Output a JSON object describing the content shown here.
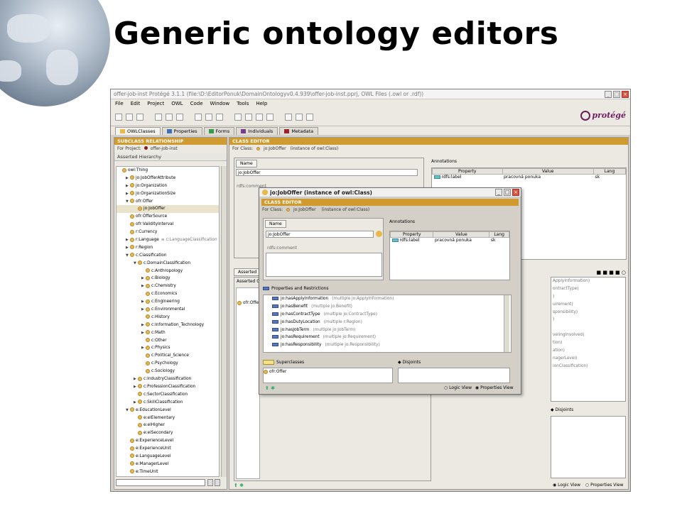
{
  "slide": {
    "title": "Generic ontology editors"
  },
  "window": {
    "title": "offer-job-inst  Protégé 3.1.1    (file:\\D:\\EditorPonuk\\DomainOntologyv0.4.939\\offer-job-inst.pprj, OWL Files (.owl or .rdf))",
    "logo_text": "protégé",
    "menu": [
      "File",
      "Edit",
      "Project",
      "OWL",
      "Code",
      "Window",
      "Tools",
      "Help"
    ],
    "tabs": [
      {
        "label": "OWLClasses",
        "color": "#e8b84a"
      },
      {
        "label": "Properties",
        "color": "#3f6fb8"
      },
      {
        "label": "Forms",
        "color": "#3a9a4a"
      },
      {
        "label": "Individuals",
        "color": "#7a3a8a"
      },
      {
        "label": "Metadata",
        "color": "#a0202a"
      }
    ]
  },
  "left": {
    "header": "SUBCLASS RELATIONSHIP",
    "for_project_label": "For Project:",
    "project": "offer-job-inst",
    "hierarchy_label": "Asserted Hierarchy",
    "tree": [
      {
        "label": "owl:Thing",
        "indent": 0,
        "arrow": ""
      },
      {
        "label": "jo:JobOfferAttribute",
        "indent": 1,
        "arrow": "▶"
      },
      {
        "label": "jo:Organization",
        "indent": 1,
        "arrow": "▶"
      },
      {
        "label": "jo:OrganizationSize",
        "indent": 1,
        "arrow": "▶"
      },
      {
        "label": "ofr:Offer",
        "indent": 1,
        "arrow": "▼"
      },
      {
        "label": "jo:JobOffer",
        "indent": 2,
        "arrow": "",
        "selected": true
      },
      {
        "label": "ofr:OfferSource",
        "indent": 1,
        "arrow": ""
      },
      {
        "label": "ofr:ValidityInterval",
        "indent": 1,
        "arrow": ""
      },
      {
        "label": "r:Currency",
        "indent": 1,
        "arrow": ""
      },
      {
        "label": "r:Language",
        "indent": 1,
        "arrow": "▶",
        "extra": "≡ c:LanguageClassification"
      },
      {
        "label": "r:Region",
        "indent": 1,
        "arrow": "▶"
      },
      {
        "label": "c:Classification",
        "indent": 1,
        "arrow": "▼"
      },
      {
        "label": "c:DomainClassification",
        "indent": 2,
        "arrow": "▼"
      },
      {
        "label": "c:Anthropology",
        "indent": 3,
        "arrow": ""
      },
      {
        "label": "c:Biology",
        "indent": 3,
        "arrow": "▶"
      },
      {
        "label": "c:Chemistry",
        "indent": 3,
        "arrow": "▶"
      },
      {
        "label": "c:Economics",
        "indent": 3,
        "arrow": ""
      },
      {
        "label": "c:Engineering",
        "indent": 3,
        "arrow": "▶"
      },
      {
        "label": "c:Environmental",
        "indent": 3,
        "arrow": "▶"
      },
      {
        "label": "c:History",
        "indent": 3,
        "arrow": ""
      },
      {
        "label": "c:Information_Technology",
        "indent": 3,
        "arrow": "▶"
      },
      {
        "label": "c:Math",
        "indent": 3,
        "arrow": "▶"
      },
      {
        "label": "c:Other",
        "indent": 3,
        "arrow": ""
      },
      {
        "label": "c:Physics",
        "indent": 3,
        "arrow": "▶"
      },
      {
        "label": "c:Political_Science",
        "indent": 3,
        "arrow": ""
      },
      {
        "label": "c:Psychology",
        "indent": 3,
        "arrow": ""
      },
      {
        "label": "c:Sociology",
        "indent": 3,
        "arrow": ""
      },
      {
        "label": "c:IndustryClassification",
        "indent": 2,
        "arrow": "▶"
      },
      {
        "label": "c:ProfessionClassification",
        "indent": 2,
        "arrow": "▶"
      },
      {
        "label": "c:SectorClassification",
        "indent": 2,
        "arrow": ""
      },
      {
        "label": "c:SkillClassification",
        "indent": 2,
        "arrow": "▶"
      },
      {
        "label": "e:EducationLevel",
        "indent": 1,
        "arrow": "▼"
      },
      {
        "label": "e:elElementary",
        "indent": 2,
        "arrow": ""
      },
      {
        "label": "e:elHigher",
        "indent": 2,
        "arrow": ""
      },
      {
        "label": "e:elSecondary",
        "indent": 2,
        "arrow": ""
      },
      {
        "label": "e:ExperienceLevel",
        "indent": 1,
        "arrow": ""
      },
      {
        "label": "e:ExperienceUnit",
        "indent": 1,
        "arrow": ""
      },
      {
        "label": "e:LanguageLevel",
        "indent": 1,
        "arrow": ""
      },
      {
        "label": "e:ManagerLevel",
        "indent": 1,
        "arrow": ""
      },
      {
        "label": "e:TimeUnit",
        "indent": 1,
        "arrow": ""
      }
    ]
  },
  "editor": {
    "header": "CLASS EDITOR",
    "for_class_label": "For Class:",
    "class_name": "jo:JobOffer",
    "instance_of": "(instance of owl:Class)",
    "name_tab": "Name",
    "name_value": "jo:JobOffer",
    "rdfs_comment": "rdfs:comment",
    "annotations_label": "Annotations",
    "ann_cols": [
      "Property",
      "Value",
      "Lang"
    ],
    "ann_row": {
      "property": "rdfs:label",
      "value": "pracovná ponuka",
      "lang": "sk"
    },
    "asserted_tab": "Asserted",
    "asserted_cond_label": "Asserted C",
    "asserted_item": "ofr:Offer",
    "disjoints_label": "Disjoints",
    "logic_view": "Logic View",
    "properties_view": "Properties View",
    "right_list": [
      "ApplyInformation)",
      "ontractType)",
      ")",
      "uirement)",
      "sponsibility)",
      ")",
      "",
      "velingInvolved)",
      "tion)",
      "ation)",
      "nagerLevel)",
      "ionClassification)"
    ]
  },
  "dialog": {
    "title": "jo:JobOffer    (instance of owl:Class)",
    "header": "CLASS EDITOR",
    "for_class_label": "For Class:",
    "class_name": "jo:JobOffer",
    "instance_of": "(instance of owl:Class)",
    "name_tab": "Name",
    "name_value": "jo:JobOffer",
    "rdfs_comment": "rdfs:comment",
    "annotations_label": "Annotations",
    "ann_cols": [
      "Property",
      "Value",
      "Lang"
    ],
    "ann_row": {
      "property": "rdfs:label",
      "value": "pracovná ponuka",
      "lang": "sk"
    },
    "props_label": "Properties and Restrictions",
    "properties": [
      {
        "name": "jo:hasApplyInformation",
        "range": "(multiple jo:ApplyInformation)"
      },
      {
        "name": "jo:hasBenefit",
        "range": "(multiple jo:Benefit)"
      },
      {
        "name": "jo:hasContractType",
        "range": "(multiple jo:ContractType)"
      },
      {
        "name": "jo:hasDutyLocation",
        "range": "(multiple r:Region)"
      },
      {
        "name": "jo:hasJobTerm",
        "range": "(multiple jo:JobTerm)"
      },
      {
        "name": "jo:hasRequirement",
        "range": "(multiple jo:Requirement)"
      },
      {
        "name": "jo:hasResponsibility",
        "range": "(multiple jo:Responsibility)"
      }
    ],
    "superclasses_label": "Superclasses",
    "superclass": "ofr:Offer",
    "disjoints_label": "Disjoints",
    "logic_view": "Logic View",
    "properties_view": "Properties View"
  }
}
